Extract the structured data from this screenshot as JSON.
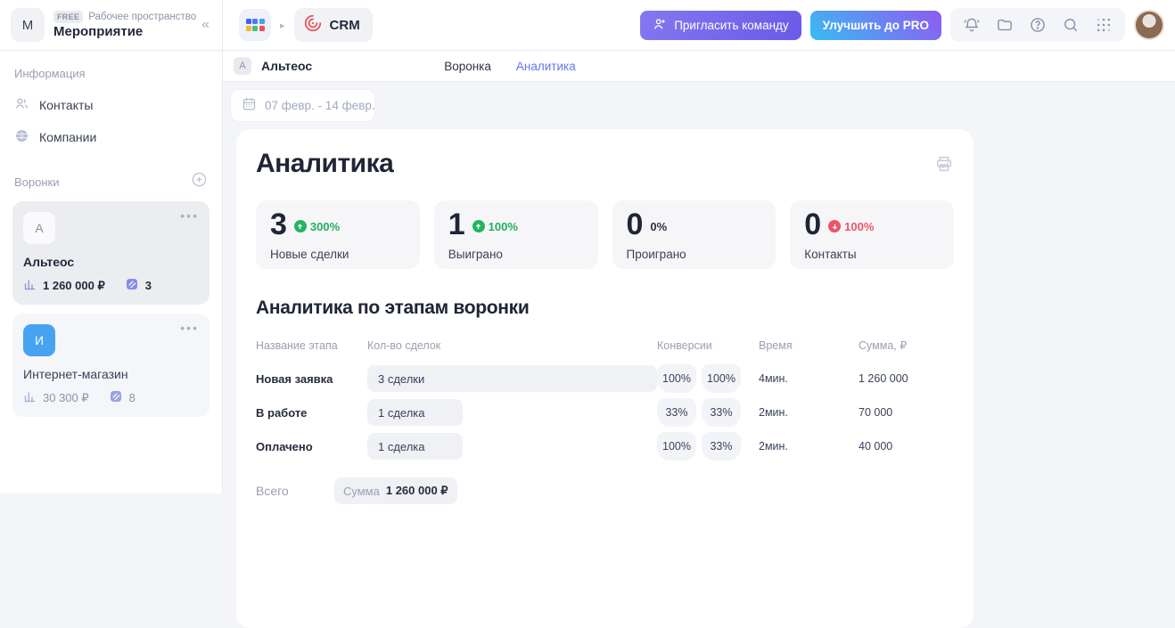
{
  "workspace": {
    "initial": "M",
    "plan_badge": "FREE",
    "type_label": "Рабочее пространство",
    "name": "Мероприятие"
  },
  "sidebar": {
    "info_section_label": "Информация",
    "nav": [
      {
        "label": "Контакты",
        "icon": "people-icon"
      },
      {
        "label": "Компании",
        "icon": "globe-icon"
      }
    ],
    "funnels_label": "Воронки",
    "funnels": [
      {
        "initial": "А",
        "name": "Альтеос",
        "amount": "1 260 000 ₽",
        "count": "3",
        "selected": true
      },
      {
        "initial": "И",
        "name": "Интернет-магазин",
        "amount": "30 300 ₽",
        "count": "8",
        "selected": false
      }
    ]
  },
  "topbar": {
    "app_name": "CRM",
    "invite_button": "Пригласить команду",
    "upgrade_button": "Улучшить до PRO",
    "icons": [
      "bell-icon",
      "folder-icon",
      "help-icon",
      "search-icon",
      "apps-dots-icon"
    ]
  },
  "subbar": {
    "funnel_initial": "А",
    "funnel_name": "Альтеос",
    "tabs": [
      {
        "label": "Воронка",
        "active": false
      },
      {
        "label": "Аналитика",
        "active": true
      }
    ]
  },
  "filters": {
    "date_range": "07 февр. - 14 февр."
  },
  "analytics": {
    "title": "Аналитика",
    "stats": [
      {
        "value": "3",
        "change": "300%",
        "direction": "up",
        "label": "Новые сделки"
      },
      {
        "value": "1",
        "change": "100%",
        "direction": "up",
        "label": "Выиграно"
      },
      {
        "value": "0",
        "change": "0%",
        "direction": "flat",
        "label": "Проиграно"
      },
      {
        "value": "0",
        "change": "100%",
        "direction": "down",
        "label": "Контакты"
      }
    ],
    "stages_title": "Аналитика по этапам воронки",
    "table": {
      "headers": [
        "Название этапа",
        "Кол-во сделок",
        "Конверсии",
        "Время",
        "Сумма, ₽"
      ],
      "rows": [
        {
          "stage": "Новая заявка",
          "deals": "3 сделки",
          "bar_pct": 100,
          "conv1": "100%",
          "conv2": "100%",
          "time": "4мин.",
          "sum": "1 260 000"
        },
        {
          "stage": "В работе",
          "deals": "1 сделка",
          "bar_pct": 33,
          "conv1": "33%",
          "conv2": "33%",
          "time": "2мин.",
          "sum": "70 000"
        },
        {
          "stage": "Оплачено",
          "deals": "1 сделка",
          "bar_pct": 33,
          "conv1": "100%",
          "conv2": "33%",
          "time": "2мин.",
          "sum": "40 000"
        }
      ],
      "total_label": "Всего",
      "total_sum_label": "Сумма",
      "total_sum_value": "1 260 000 ₽"
    }
  },
  "colors": {
    "accent_tab": "#6474f4",
    "green_up": "#23b561",
    "red_down": "#ef5365",
    "invite_gradient": [
      "#8478f0",
      "#6a5ae8"
    ],
    "pro_gradient": [
      "#38bdf2",
      "#9059f2"
    ],
    "funnel_avatar_blue": "#47a3f2",
    "crm_logo_red": "#e45a5e"
  }
}
